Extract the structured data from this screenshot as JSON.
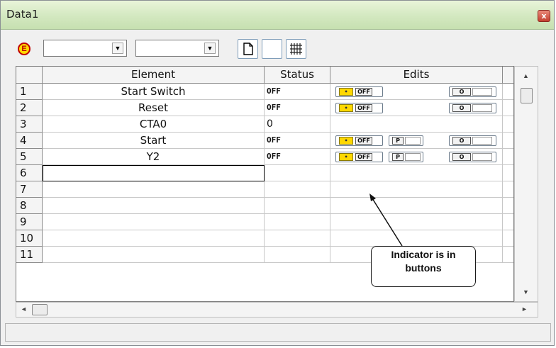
{
  "window": {
    "title": "Data1",
    "close_glyph": "x"
  },
  "toolbar": {
    "edit_mode_icon": {
      "name": "edit-mode-icon",
      "glyph": "E"
    },
    "select1": {
      "value": ""
    },
    "select2": {
      "value": ""
    },
    "buttons": [
      "new-document-icon",
      "blank-button",
      "timing-chart-icon"
    ]
  },
  "grid": {
    "headers": {
      "element": "Element",
      "status": "Status",
      "edits": "Edits"
    },
    "rows": [
      {
        "num": "1",
        "element": "Start Switch",
        "status": "OFF",
        "edits": [
          "bulb-off",
          "o"
        ]
      },
      {
        "num": "2",
        "element": "Reset",
        "status": "OFF",
        "edits": [
          "bulb-off",
          "o"
        ]
      },
      {
        "num": "3",
        "element": "CTA0",
        "status": "0",
        "edits": []
      },
      {
        "num": "4",
        "element": "Start",
        "status": "OFF",
        "edits": [
          "bulb-off",
          "p",
          "o"
        ]
      },
      {
        "num": "5",
        "element": "Y2",
        "status": "OFF",
        "edits": [
          "bulb-off",
          "p",
          "o"
        ]
      },
      {
        "num": "6",
        "element": "",
        "status": "",
        "edits": []
      },
      {
        "num": "7",
        "element": "",
        "status": "",
        "edits": []
      },
      {
        "num": "8",
        "element": "",
        "status": "",
        "edits": []
      },
      {
        "num": "9",
        "element": "",
        "status": "",
        "edits": []
      },
      {
        "num": "10",
        "element": "",
        "status": "",
        "edits": []
      },
      {
        "num": "11",
        "element": "",
        "status": "",
        "edits": []
      }
    ],
    "pill_labels": {
      "off": "OFF",
      "p": "P",
      "o": "O"
    }
  },
  "scroll": {
    "up_glyph": "▲",
    "down_glyph": "▼",
    "left_glyph": "◄",
    "right_glyph": "►"
  },
  "callout": {
    "line1": "Indicator is in",
    "line2": "buttons"
  },
  "colors": {
    "accent_title": "#d3e8c0",
    "bulb": "#ffd800",
    "close": "#c4402f"
  }
}
